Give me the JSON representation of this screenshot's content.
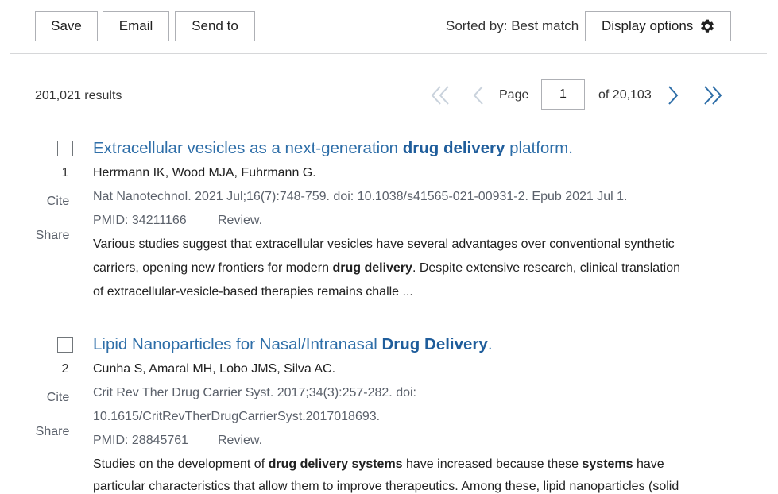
{
  "toolbar": {
    "save_label": "Save",
    "email_label": "Email",
    "send_to_label": "Send to",
    "sorted_by": "Sorted by: Best match",
    "display_options_label": "Display options",
    "display_options_icon": "gear-icon"
  },
  "results_bar": {
    "count": "201,021 results",
    "page_label": "Page",
    "page_value": "1",
    "page_total": "of 20,103",
    "icons": [
      "first-page-icon",
      "previous-page-icon",
      "next-page-icon",
      "last-page-icon"
    ]
  },
  "results": [
    {
      "index": "1",
      "title_pre": "Extracellular vesicles as a next-generation ",
      "title_bold": "drug delivery",
      "title_post": " platform.",
      "authors": "Herrmann IK, Wood MJA, Fuhrmann G.",
      "citation_line1": "Nat Nanotechnol. 2021 Jul;16(7):748-759. doi: 10.1038/s41565-021-00931-2. Epub 2021 Jul 1.",
      "pmid": "PMID: 34211166",
      "type": "Review.",
      "cite_label": "Cite",
      "share_label": "Share",
      "snippet_line1": "Various studies suggest that extracellular vesicles have several advantages over conventional synthetic",
      "snippet_line2_pre": "carriers, opening new frontiers for modern ",
      "snippet_line2_bold": "drug delivery",
      "snippet_line2_post": ". Despite extensive research, clinical translation",
      "snippet_line3": "of extracellular-vesicle-based therapies remains challe ..."
    },
    {
      "index": "2",
      "title_pre": "Lipid Nanoparticles for Nasal/Intranasal ",
      "title_bold": "Drug Delivery",
      "title_post": ".",
      "authors": "Cunha S, Amaral MH, Lobo JMS, Silva AC.",
      "citation_line1": "Crit Rev Ther Drug Carrier Syst. 2017;34(3):257-282. doi:",
      "citation_line2": "10.1615/CritRevTherDrugCarrierSyst.2017018693.",
      "pmid": "PMID: 28845761",
      "type": "Review.",
      "cite_label": "Cite",
      "share_label": "Share",
      "snippet_line1_a": "Studies on the development of ",
      "snippet_line1_b": "drug delivery systems",
      "snippet_line1_c": " have increased because these ",
      "snippet_line1_d": "systems",
      "snippet_line1_e": " have",
      "snippet_line2": "particular characteristics that allow them to improve therapeutics. Among these, lipid nanoparticles (solid"
    }
  ],
  "colors": {
    "title_link": "#2e6ea8",
    "muted_text": "#5b616b",
    "border": "#aeb0b5",
    "pager_arrow_disabled": "#c9d2dc",
    "pager_arrow_active": "#2e6ea8"
  }
}
